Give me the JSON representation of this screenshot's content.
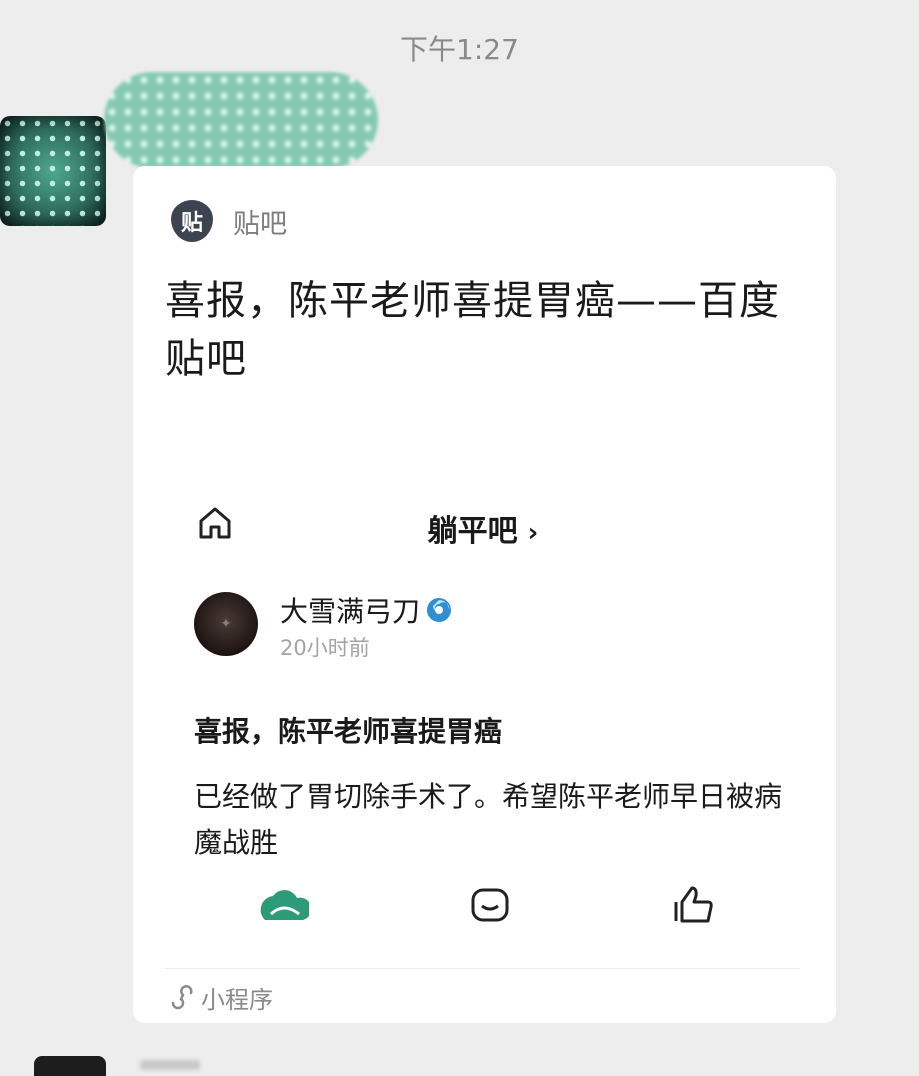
{
  "chat": {
    "timestamp": "下午1:27"
  },
  "card": {
    "source_label": "贴吧",
    "source_icon_text": "贴",
    "title": "喜报，陈平老师喜提胃癌——百度贴吧",
    "footer_label": "小程序"
  },
  "preview": {
    "forum_name": "躺平吧",
    "chevron": "›",
    "author": "大雪满弓刀",
    "time": "20小时前",
    "post_title": "喜报，陈平老师喜提胃癌",
    "post_body": "已经做了胃切除手术了。希望陈平老师早日被病魔战胜"
  },
  "icons": {
    "home": "home-icon",
    "verified": "verified-badge-icon",
    "share": "share-cloud-icon",
    "comment": "comment-icon",
    "like": "thumbs-up-icon",
    "mini_program": "mini-program-icon"
  },
  "colors": {
    "accent_green": "#2e9b78",
    "background": "#ededed",
    "card": "#ffffff",
    "verified_blue": "#2f8fd3"
  }
}
